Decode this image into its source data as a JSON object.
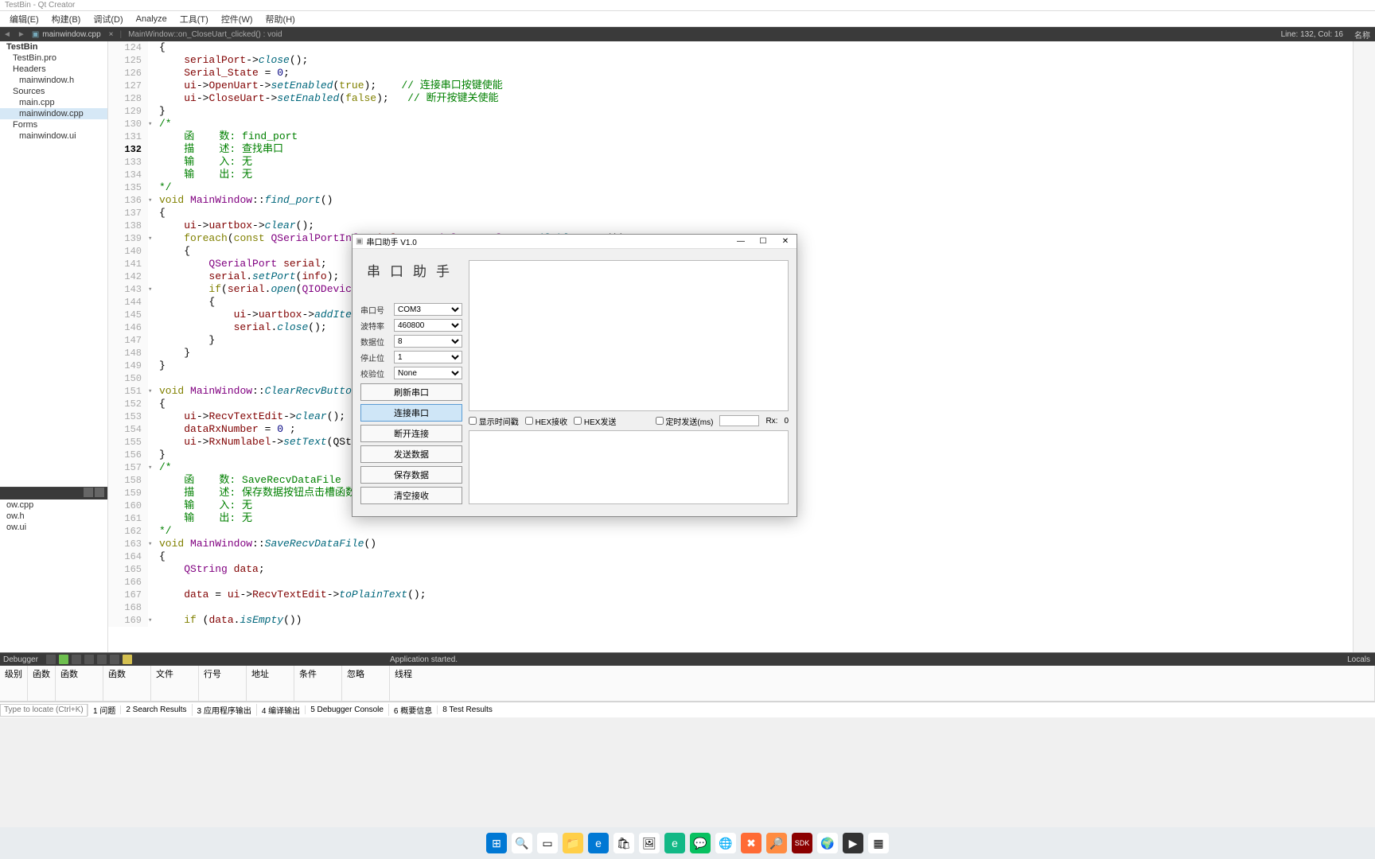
{
  "titlebar": "TestBin - Qt Creator",
  "menubar": [
    "编辑(E)",
    "构建(B)",
    "调试(D)",
    "Analyze",
    "工具(T)",
    "控件(W)",
    "帮助(H)"
  ],
  "navbar": {
    "file": "mainwindow.cpp",
    "method": "MainWindow::on_CloseUart_clicked() : void",
    "line_col": "Line: 132, Col: 16"
  },
  "project_tree": {
    "root": "TestBin",
    "items": [
      {
        "label": "TestBin.pro",
        "indent": 1
      },
      {
        "label": "Headers",
        "indent": 1
      },
      {
        "label": "mainwindow.h",
        "indent": 2
      },
      {
        "label": "Sources",
        "indent": 1
      },
      {
        "label": "main.cpp",
        "indent": 2
      },
      {
        "label": "mainwindow.cpp",
        "indent": 2,
        "selected": true
      },
      {
        "label": "Forms",
        "indent": 1
      },
      {
        "label": "mainwindow.ui",
        "indent": 2
      }
    ]
  },
  "open_docs": [
    "ow.cpp",
    "ow.h",
    "ow.ui"
  ],
  "code": [
    {
      "n": 124,
      "t": "{"
    },
    {
      "n": 125,
      "t": "    serialPort->close();"
    },
    {
      "n": 126,
      "t": "    Serial_State = 0;"
    },
    {
      "n": 127,
      "t": "    ui->OpenUart->setEnabled(true);    // 连接串口按键使能"
    },
    {
      "n": 128,
      "t": "    ui->CloseUart->setEnabled(false);   // 断开按键关使能"
    },
    {
      "n": 129,
      "t": "}"
    },
    {
      "n": 130,
      "t": "/*",
      "fold": "v"
    },
    {
      "n": 131,
      "t": "    函    数: find_port"
    },
    {
      "n": 132,
      "t": "    描    述: 查找串口",
      "current": true
    },
    {
      "n": 133,
      "t": "    输    入: 无"
    },
    {
      "n": 134,
      "t": "    输    出: 无"
    },
    {
      "n": 135,
      "t": "*/"
    },
    {
      "n": 136,
      "t": "void MainWindow::find_port()",
      "fold": "v"
    },
    {
      "n": 137,
      "t": "{"
    },
    {
      "n": 138,
      "t": "    ui->uartbox->clear();"
    },
    {
      "n": 139,
      "t": "    foreach(const QSerialPortInfo &info, QSerialPortInfo::availablePorts())",
      "fold": "v"
    },
    {
      "n": 140,
      "t": "    {"
    },
    {
      "n": 141,
      "t": "        QSerialPort serial;"
    },
    {
      "n": 142,
      "t": "        serial.setPort(info);   //"
    },
    {
      "n": 143,
      "t": "        if(serial.open(QIODevice::",
      "fold": "v"
    },
    {
      "n": 144,
      "t": "        {"
    },
    {
      "n": 145,
      "t": "            ui->uartbox->addItem(s"
    },
    {
      "n": 146,
      "t": "            serial.close();"
    },
    {
      "n": 147,
      "t": "        }"
    },
    {
      "n": 148,
      "t": "    }"
    },
    {
      "n": 149,
      "t": "}"
    },
    {
      "n": 150,
      "t": ""
    },
    {
      "n": 151,
      "t": "void MainWindow::ClearRecvButton()",
      "fold": "v"
    },
    {
      "n": 152,
      "t": "{"
    },
    {
      "n": 153,
      "t": "    ui->RecvTextEdit->clear();"
    },
    {
      "n": 154,
      "t": "    dataRxNumber = 0 ;"
    },
    {
      "n": 155,
      "t": "    ui->RxNumlabel->setText(QStrin"
    },
    {
      "n": 156,
      "t": "}"
    },
    {
      "n": 157,
      "t": "/*",
      "fold": "v"
    },
    {
      "n": 158,
      "t": "    函    数: SaveRecvDataFile"
    },
    {
      "n": 159,
      "t": "    描    述: 保存数据按钮点击槽函数"
    },
    {
      "n": 160,
      "t": "    输    入: 无"
    },
    {
      "n": 161,
      "t": "    输    出: 无"
    },
    {
      "n": 162,
      "t": "*/"
    },
    {
      "n": 163,
      "t": "void MainWindow::SaveRecvDataFile()",
      "fold": "v"
    },
    {
      "n": 164,
      "t": "{"
    },
    {
      "n": 165,
      "t": "    QString data;"
    },
    {
      "n": 166,
      "t": ""
    },
    {
      "n": 167,
      "t": "    data = ui->RecvTextEdit->toPlainText();"
    },
    {
      "n": 168,
      "t": ""
    },
    {
      "n": 169,
      "t": "    if (data.isEmpty())",
      "fold": "v"
    }
  ],
  "debug": {
    "label": "Debugger",
    "status": "Application started.",
    "columns": [
      "级别",
      "函数",
      "函数",
      "函数",
      "文件",
      "行号",
      "地址",
      "条件",
      "忽略",
      "线程"
    ],
    "right_label": "Locals"
  },
  "locator": {
    "placeholder": "Type to locate (Ctrl+K)",
    "tabs": [
      "1 问题",
      "2 Search Results",
      "3 应用程序输出",
      "4 编译输出",
      "5 Debugger Console",
      "6 概要信息",
      "8 Test Results"
    ]
  },
  "right_panel": "名称",
  "dialog": {
    "title": "串口助手 V1.0",
    "heading": "串口助手",
    "fields": {
      "port_label": "串口号",
      "port_value": "COM3",
      "baud_label": "波特率",
      "baud_value": "460800",
      "data_label": "数据位",
      "data_value": "8",
      "stop_label": "停止位",
      "stop_value": "1",
      "parity_label": "校验位",
      "parity_value": "None"
    },
    "buttons": {
      "refresh": "刷新串口",
      "connect": "连接串口",
      "disconnect": "断开连接",
      "send": "发送数据",
      "save": "保存数据",
      "clear": "清空接收"
    },
    "options": {
      "timestamp": "显示时间戳",
      "hex_recv": "HEX接收",
      "hex_send": "HEX发送",
      "timed_send": "定时发送(ms)",
      "rx_label": "Rx:",
      "rx_value": "0"
    }
  },
  "taskbar_icons": [
    "start",
    "search",
    "taskview",
    "explorer",
    "edge",
    "store",
    "photos",
    "edge2",
    "wechat",
    "chrome",
    "todesk",
    "everything",
    "sdk",
    "browser",
    "play",
    "app"
  ]
}
